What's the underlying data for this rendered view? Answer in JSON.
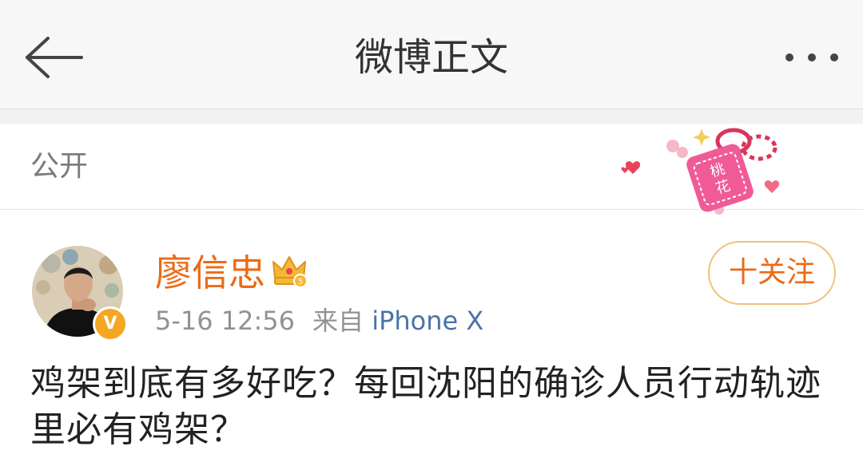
{
  "nav": {
    "title": "微博正文",
    "back_icon": "arrow-left-icon",
    "more_icon": "ellipsis-icon"
  },
  "visibility": {
    "label": "公开",
    "sticker_text": "桃花"
  },
  "post": {
    "author": {
      "name": "廖信忠",
      "verified_badge": "V",
      "name_color": "#ec6a15",
      "badge_color": "#f5a623"
    },
    "timestamp": "5-16 12:56",
    "source_prefix": "来自",
    "source_device": "iPhone X",
    "follow_label": "十关注",
    "text": "鸡架到底有多好吃？每回沈阳的确诊人员行动轨迹里必有鸡架？"
  }
}
